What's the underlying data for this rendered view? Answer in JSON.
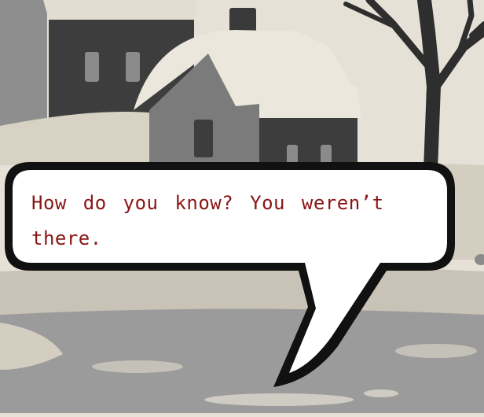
{
  "dialogue": {
    "text": "How do you know? You weren’t there."
  },
  "colors": {
    "sky": "#e6e1d6",
    "snow": "#d9d3c6",
    "dark_house": "#3d3d3d",
    "mid_house": "#7b7b7b",
    "roof_snow": "#ece7dc",
    "ground": "#9b9b9b",
    "puddle": "#b8b6af",
    "tree": "#2e2e2e",
    "bubble_fill": "#ffffff",
    "bubble_outline": "#111111",
    "text": "#8a1414"
  }
}
